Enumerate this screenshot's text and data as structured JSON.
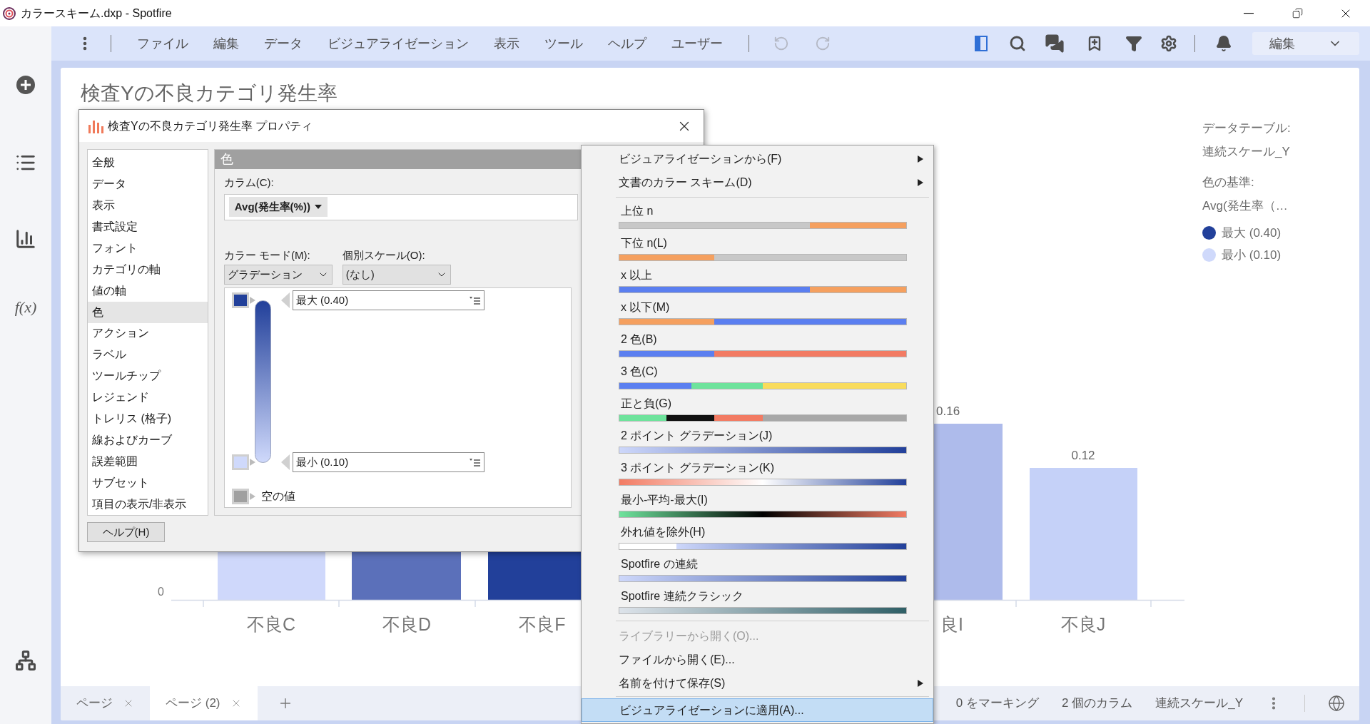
{
  "window": {
    "title": "カラースキーム.dxp - Spotfire"
  },
  "sidebar": {
    "expression_label": "f(x)"
  },
  "toolbar": {
    "menus": [
      "ファイル",
      "編集",
      "データ",
      "ビジュアライゼーション",
      "表示",
      "ツール",
      "ヘルプ",
      "ユーザー"
    ],
    "history": [
      {
        "kind": "undo",
        "disabled": true
      },
      {
        "kind": "redo",
        "disabled": true
      }
    ],
    "mode": "編集"
  },
  "page": {
    "title": "検査Yの不良カテゴリ発生率",
    "chart": {
      "y_tick": "0",
      "bars": [
        {
          "category": "不良C",
          "color": "#cfd8fb"
        },
        {
          "category": "不良D",
          "color": "#5b70ba"
        },
        {
          "category": "不良F",
          "color": "#22409a"
        },
        {
          "category": "良I",
          "value_label": "0.16",
          "color": "#aebbeb"
        },
        {
          "category": "不良J",
          "value_label": "0.12",
          "color": "#c5d1f8"
        }
      ]
    },
    "legend": {
      "table_label": "データテーブル:",
      "table_name": "連続スケール_Y",
      "color_by_label": "色の基準:",
      "color_by": "Avg(発生率（…",
      "items": [
        {
          "label": "最大 (0.40)",
          "color": "#22409a"
        },
        {
          "label": "最小 (0.10)",
          "color": "#cfd9fb"
        }
      ]
    }
  },
  "tabs": [
    {
      "label": "ページ",
      "selected": false
    },
    {
      "label": "ページ (2)",
      "selected": true
    }
  ],
  "status_bar": [
    "0 をマーキング",
    "2 個のカラム",
    "連続スケール_Y"
  ],
  "dialog": {
    "title": "検査Yの不良カテゴリ発生率 プロパティ",
    "nav": [
      {
        "label": "全般",
        "selected": false
      },
      {
        "label": "データ",
        "selected": false
      },
      {
        "label": "表示",
        "selected": false
      },
      {
        "label": "書式設定",
        "selected": false
      },
      {
        "label": "フォント",
        "selected": false
      },
      {
        "label": "カテゴリの軸",
        "selected": false
      },
      {
        "label": "値の軸",
        "selected": false
      },
      {
        "label": "色",
        "selected": true
      },
      {
        "label": "アクション",
        "selected": false
      },
      {
        "label": "ラベル",
        "selected": false
      },
      {
        "label": "ツールチップ",
        "selected": false
      },
      {
        "label": "レジェンド",
        "selected": false
      },
      {
        "label": "トレリス (格子)",
        "selected": false
      },
      {
        "label": "線およびカーブ",
        "selected": false
      },
      {
        "label": "誤差範囲",
        "selected": false
      },
      {
        "label": "サブセット",
        "selected": false
      },
      {
        "label": "項目の表示/非表示",
        "selected": false
      }
    ],
    "section": "色",
    "column_label": "カラム(C):",
    "column_value": "Avg(発生率(%))",
    "color_mode_label": "カラー モード(M):",
    "color_mode": "グラデーション",
    "scale_label": "個別スケール(O):",
    "scale": "(なし)",
    "points": [
      {
        "label": "最大 (0.40)",
        "color": "#22409a"
      },
      {
        "label": "最小 (0.10)",
        "color": "#cfd9fb"
      }
    ],
    "empty_value": {
      "label": "空の値",
      "color": "#a0a0a0"
    },
    "help": "ヘルプ(H)"
  },
  "menu": {
    "top": [
      {
        "label": "ビジュアライゼーションから(F)",
        "submenu": true
      },
      {
        "label": "文書のカラー スキーム(D)",
        "submenu": true
      }
    ],
    "schemes": [
      {
        "label": "上位 n"
      },
      {
        "label": "下位 n(L)"
      },
      {
        "label": "x 以上"
      },
      {
        "label": "x 以下(M)"
      },
      {
        "label": "2 色(B)"
      },
      {
        "label": "3 色(C)"
      },
      {
        "label": "正と負(G)"
      },
      {
        "label": "2 ポイント グラデーション(J)"
      },
      {
        "label": "3 ポイント グラデーション(K)"
      },
      {
        "label": "最小-平均-最大(I)"
      },
      {
        "label": "外れ値を除外(H)"
      },
      {
        "label": "Spotfire の連続"
      },
      {
        "label": "Spotfire 連続クラシック"
      }
    ],
    "actions": [
      {
        "label": "ライブラリーから開く(O)...",
        "disabled": true,
        "submenu": false,
        "highlighted": false
      },
      {
        "label": "ファイルから開く(E)...",
        "disabled": false,
        "submenu": false,
        "highlighted": false
      },
      {
        "label": "名前を付けて保存(S)",
        "disabled": false,
        "submenu": true,
        "highlighted": false
      },
      {
        "label": "ビジュアライゼーションに適用(A)...",
        "disabled": false,
        "submenu": false,
        "highlighted": true
      }
    ]
  }
}
